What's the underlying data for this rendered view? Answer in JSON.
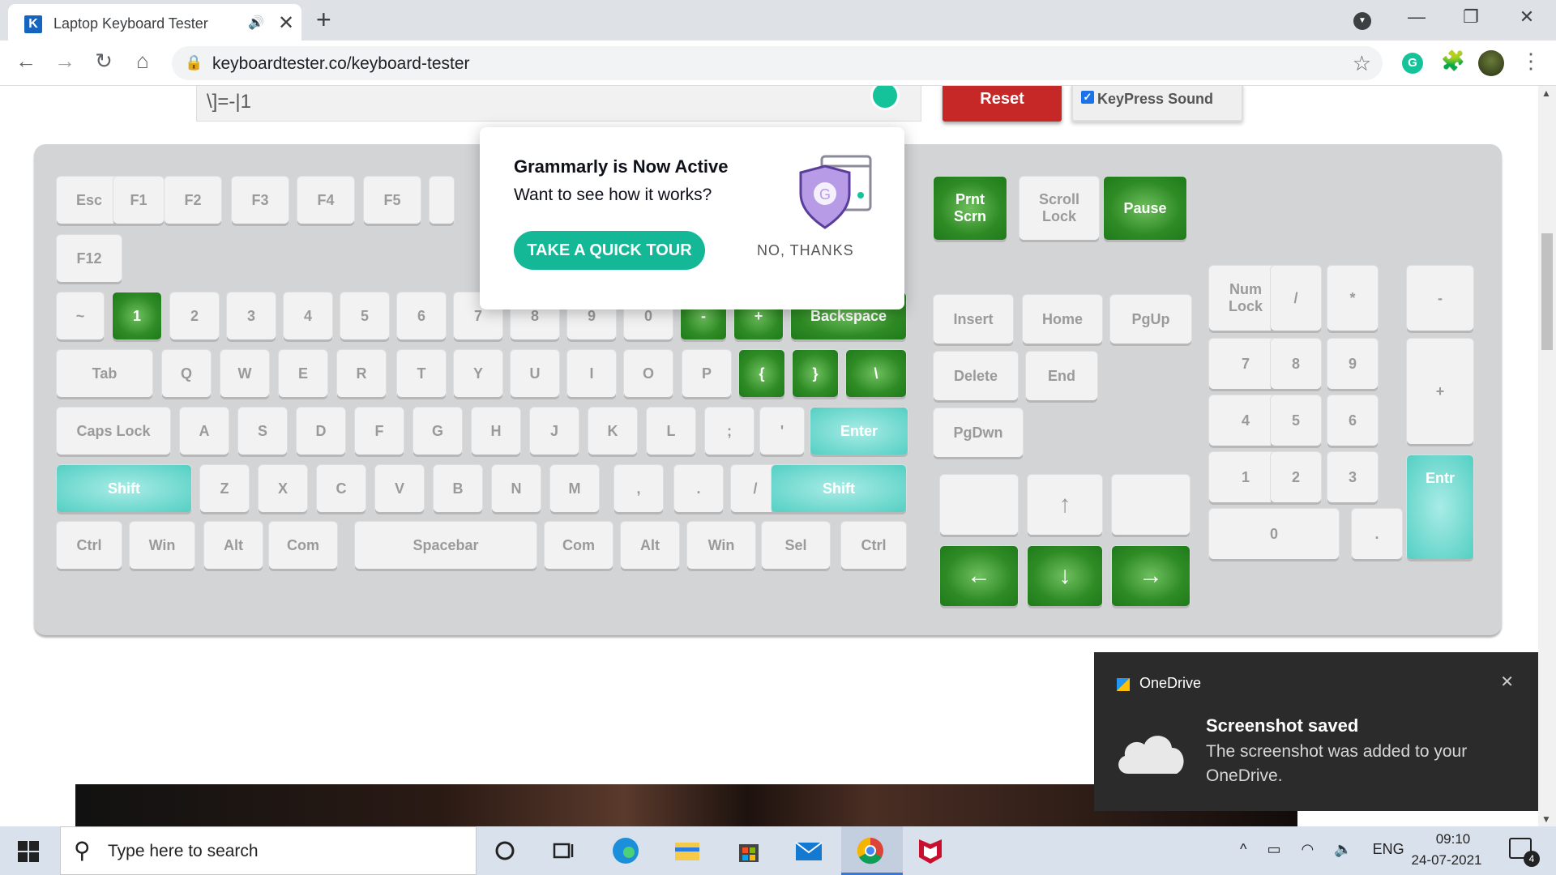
{
  "tab": {
    "title": "Laptop Keyboard Tester",
    "favicon": "K",
    "audio_icon": "🔊",
    "close": "✕",
    "new_tab": "+"
  },
  "window": {
    "minimize": "—",
    "restore": "❐",
    "close": "✕"
  },
  "nav": {
    "back": "←",
    "forward": "→",
    "reload": "↻",
    "home": "⌂",
    "url": "keyboardtester.co/keyboard-tester",
    "star": "☆",
    "grammarly": "G",
    "puzzle": "🧩",
    "menu": "⋮"
  },
  "page": {
    "textarea_value": "\\]=-|1",
    "reset_label": "Reset",
    "keypress_sound_label": "KeyPress Sound",
    "keypress_sound_checked": true
  },
  "keyboard": {
    "keys": [
      {
        "label": "Esc",
        "state": ""
      },
      {
        "label": "F1",
        "state": ""
      },
      {
        "label": "F2",
        "state": ""
      },
      {
        "label": "F3",
        "state": ""
      },
      {
        "label": "F4",
        "state": ""
      },
      {
        "label": "F5",
        "state": ""
      },
      {
        "label": "",
        "state": ""
      },
      {
        "label": "F12",
        "state": ""
      },
      {
        "label": "~",
        "state": ""
      },
      {
        "label": "1",
        "state": "pressed"
      },
      {
        "label": "2",
        "state": ""
      },
      {
        "label": "3",
        "state": ""
      },
      {
        "label": "4",
        "state": ""
      },
      {
        "label": "5",
        "state": ""
      },
      {
        "label": "6",
        "state": ""
      },
      {
        "label": "7",
        "state": ""
      },
      {
        "label": "8",
        "state": ""
      },
      {
        "label": "9",
        "state": ""
      },
      {
        "label": "0",
        "state": ""
      },
      {
        "label": "-",
        "state": "pressed"
      },
      {
        "label": "+",
        "state": "pressed"
      },
      {
        "label": "Backspace",
        "state": "pressed"
      },
      {
        "label": "Tab",
        "state": ""
      },
      {
        "label": "Q",
        "state": ""
      },
      {
        "label": "W",
        "state": ""
      },
      {
        "label": "E",
        "state": ""
      },
      {
        "label": "R",
        "state": ""
      },
      {
        "label": "T",
        "state": ""
      },
      {
        "label": "Y",
        "state": ""
      },
      {
        "label": "U",
        "state": ""
      },
      {
        "label": "I",
        "state": ""
      },
      {
        "label": "O",
        "state": ""
      },
      {
        "label": "P",
        "state": ""
      },
      {
        "label": "{",
        "state": "pressed"
      },
      {
        "label": "}",
        "state": "pressed"
      },
      {
        "label": "\\",
        "state": "pressed"
      },
      {
        "label": "Caps Lock",
        "state": ""
      },
      {
        "label": "A",
        "state": ""
      },
      {
        "label": "S",
        "state": ""
      },
      {
        "label": "D",
        "state": ""
      },
      {
        "label": "F",
        "state": ""
      },
      {
        "label": "G",
        "state": ""
      },
      {
        "label": "H",
        "state": ""
      },
      {
        "label": "J",
        "state": ""
      },
      {
        "label": "K",
        "state": ""
      },
      {
        "label": "L",
        "state": ""
      },
      {
        "label": ";",
        "state": ""
      },
      {
        "label": "'",
        "state": ""
      },
      {
        "label": "Enter",
        "state": "tested"
      },
      {
        "label": "Shift",
        "state": "tested"
      },
      {
        "label": "Z",
        "state": ""
      },
      {
        "label": "X",
        "state": ""
      },
      {
        "label": "C",
        "state": ""
      },
      {
        "label": "V",
        "state": ""
      },
      {
        "label": "B",
        "state": ""
      },
      {
        "label": "N",
        "state": ""
      },
      {
        "label": "M",
        "state": ""
      },
      {
        "label": ",",
        "state": ""
      },
      {
        "label": ".",
        "state": ""
      },
      {
        "label": "/",
        "state": ""
      },
      {
        "label": "Shift",
        "state": "tested"
      },
      {
        "label": "Ctrl",
        "state": ""
      },
      {
        "label": "Win",
        "state": ""
      },
      {
        "label": "Alt",
        "state": ""
      },
      {
        "label": "Com",
        "state": ""
      },
      {
        "label": "Spacebar",
        "state": ""
      },
      {
        "label": "Com",
        "state": ""
      },
      {
        "label": "Alt",
        "state": ""
      },
      {
        "label": "Win",
        "state": ""
      },
      {
        "label": "Sel",
        "state": ""
      },
      {
        "label": "Ctrl",
        "state": ""
      },
      {
        "label": "Prnt Scrn",
        "state": "pressed"
      },
      {
        "label": "Scroll Lock",
        "state": ""
      },
      {
        "label": "Pause",
        "state": "pressed"
      },
      {
        "label": "Insert",
        "state": ""
      },
      {
        "label": "Home",
        "state": ""
      },
      {
        "label": "PgUp",
        "state": ""
      },
      {
        "label": "Delete",
        "state": ""
      },
      {
        "label": "End",
        "state": ""
      },
      {
        "label": "PgDwn",
        "state": ""
      },
      {
        "label": "",
        "state": ""
      },
      {
        "label": "↑",
        "state": ""
      },
      {
        "label": "",
        "state": ""
      },
      {
        "label": "←",
        "state": "pressed"
      },
      {
        "label": "↓",
        "state": "pressed"
      },
      {
        "label": "→",
        "state": "pressed"
      },
      {
        "label": "Num Lock",
        "state": ""
      },
      {
        "label": "/",
        "state": ""
      },
      {
        "label": "*",
        "state": ""
      },
      {
        "label": "-",
        "state": ""
      },
      {
        "label": "7",
        "state": ""
      },
      {
        "label": "8",
        "state": ""
      },
      {
        "label": "9",
        "state": ""
      },
      {
        "label": "+",
        "state": ""
      },
      {
        "label": "4",
        "state": ""
      },
      {
        "label": "5",
        "state": ""
      },
      {
        "label": "6",
        "state": ""
      },
      {
        "label": "1",
        "state": ""
      },
      {
        "label": "2",
        "state": ""
      },
      {
        "label": "3",
        "state": ""
      },
      {
        "label": "Entr",
        "state": "tested"
      },
      {
        "label": "0",
        "state": ""
      },
      {
        "label": ".",
        "state": ""
      }
    ]
  },
  "grammarly_popup": {
    "title": "Grammarly is Now Active",
    "subtitle": "Want to see how it works?",
    "tour_button": "TAKE A QUICK TOUR",
    "decline": "NO, THANKS"
  },
  "toast": {
    "app": "OneDrive",
    "title": "Screenshot saved",
    "body": "The screenshot was added to your OneDrive.",
    "close": "✕"
  },
  "taskbar": {
    "search_placeholder": "Type here to search",
    "language": "ENG",
    "time": "09:10",
    "date": "24-07-2021",
    "notification_count": "4",
    "tray_chevron": "^"
  },
  "colors": {
    "pressed": "#2e8b24",
    "tested": "#54cfc3",
    "reset": "#c62828",
    "grammarly": "#15b896"
  }
}
